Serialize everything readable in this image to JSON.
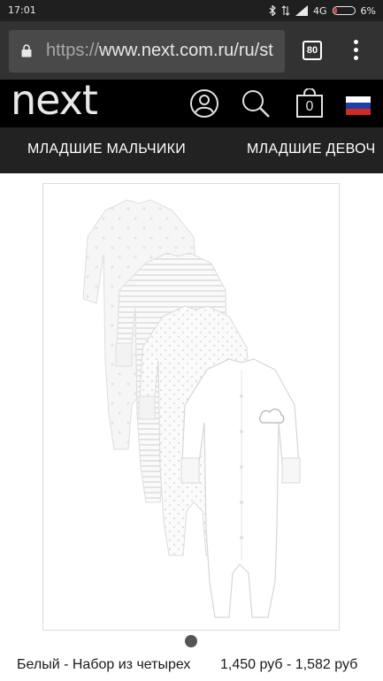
{
  "status_bar": {
    "time": "17:01",
    "network": "4G",
    "battery": "6%",
    "battery_level": 0.06,
    "icons": [
      "bluetooth-icon",
      "data-transfer-icon",
      "signal-icon",
      "battery-icon"
    ]
  },
  "browser": {
    "url_protocol": "https://",
    "url_rest": "www.next.com.ru/ru/st",
    "tab_count": "80",
    "icons": [
      "lock-icon",
      "tabs-icon",
      "more-menu-icon"
    ]
  },
  "site_header": {
    "logo": "next",
    "basket_count": "0",
    "icons": [
      "account-icon",
      "search-icon",
      "basket-icon",
      "russia-flag-icon"
    ],
    "colors": {
      "background": "#000000",
      "flag_white": "#ffffff",
      "flag_blue": "#1c3fa8",
      "flag_red": "#d52b1e"
    }
  },
  "category_nav": {
    "items": [
      "МЛАДШИЕ МАЛЬЧИКИ",
      "МЛАДШИЕ ДЕВОЧ"
    ]
  },
  "carousel": {
    "current_index": 1,
    "dot_count": 1
  },
  "product": {
    "title": "Белый - Набор из четырех",
    "price": "1,450 руб - 1,582 руб"
  }
}
